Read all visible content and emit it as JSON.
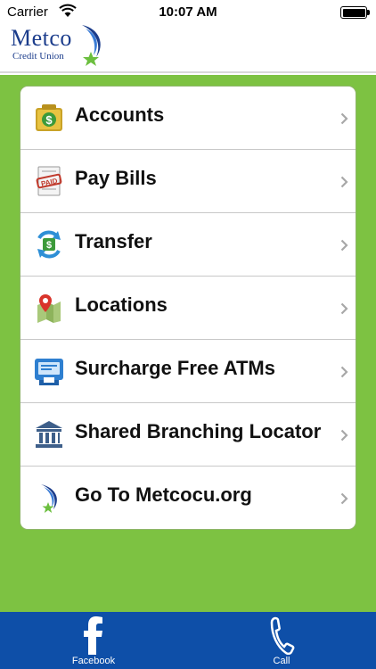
{
  "status_bar": {
    "carrier": "Carrier",
    "time": "10:07 AM",
    "battery_level": 1.0
  },
  "header": {
    "logo_name": "Metco",
    "logo_subtitle": "Credit Union"
  },
  "menu": {
    "items": [
      {
        "label": "Accounts",
        "icon": "money-bag-icon"
      },
      {
        "label": "Pay Bills",
        "icon": "paid-bill-icon"
      },
      {
        "label": "Transfer",
        "icon": "transfer-icon"
      },
      {
        "label": "Locations",
        "icon": "map-pin-icon"
      },
      {
        "label": "Surcharge Free ATMs",
        "icon": "atm-icon"
      },
      {
        "label": "Shared Branching Locator",
        "icon": "bank-building-icon"
      },
      {
        "label": "Go To Metcocu.org",
        "icon": "metco-swoosh-icon"
      }
    ]
  },
  "tabbar": {
    "facebook_label": "Facebook",
    "call_label": "Call"
  },
  "colors": {
    "green_background": "#7dc242",
    "tabbar_blue": "#0e4fa8",
    "brand_blue": "#1c3d8c"
  }
}
